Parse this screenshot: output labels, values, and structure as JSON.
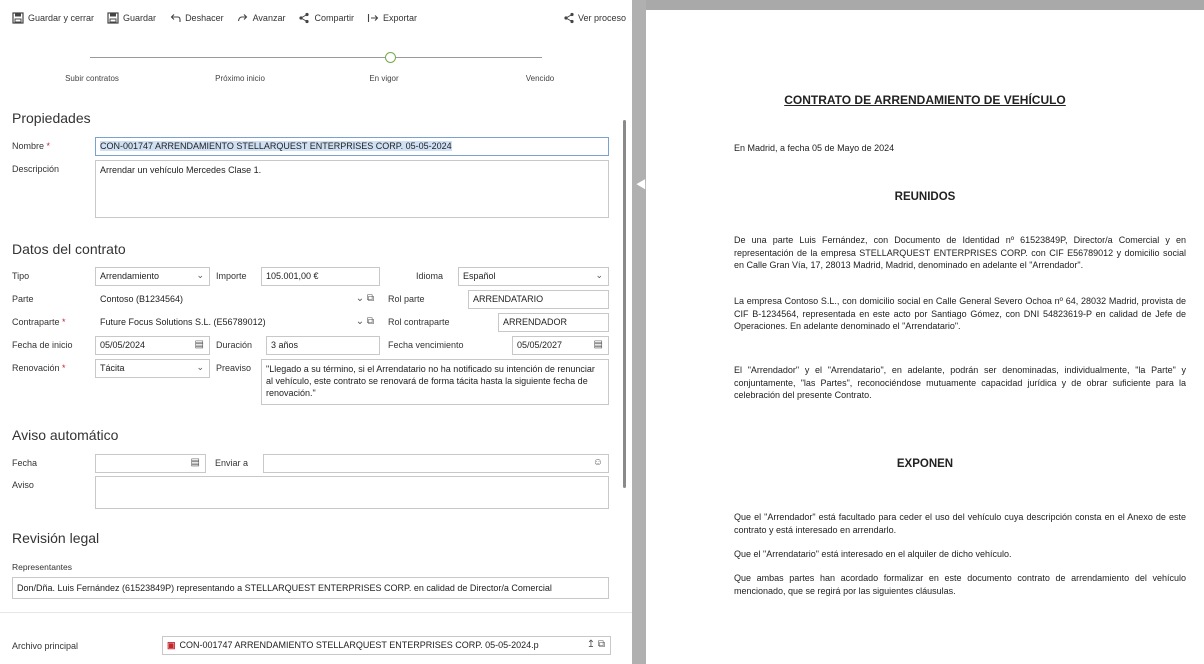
{
  "toolbar": {
    "save_close": "Guardar y cerrar",
    "save": "Guardar",
    "undo": "Deshacer",
    "redo": "Avanzar",
    "share": "Compartir",
    "export": "Exportar",
    "view_process": "Ver proceso"
  },
  "stages": [
    "Subir contratos",
    "Próximo inicio",
    "En vigor",
    "Vencido"
  ],
  "properties": {
    "title": "Propiedades",
    "name_label": "Nombre",
    "name_value": "CON-001747 ARRENDAMIENTO STELLARQUEST ENTERPRISES CORP. 05-05-2024",
    "desc_label": "Descripción",
    "desc_value": "Arrendar un vehículo Mercedes Clase 1."
  },
  "contract": {
    "title": "Datos del contrato",
    "tipo_label": "Tipo",
    "tipo_value": "Arrendamiento",
    "importe_label": "Importe",
    "importe_value": "105.001,00 €",
    "idioma_label": "Idioma",
    "idioma_value": "Español",
    "parte_label": "Parte",
    "parte_value": "Contoso (B1234564)",
    "rol_parte_label": "Rol parte",
    "rol_parte_value": "ARRENDATARIO",
    "contraparte_label": "Contraparte",
    "contraparte_value": "Future Focus Solutions S.L. (E56789012)",
    "rol_contraparte_label": "Rol contraparte",
    "rol_contraparte_value": "ARRENDADOR",
    "fecha_inicio_label": "Fecha de inicio",
    "fecha_inicio_value": "05/05/2024",
    "duracion_label": "Duración",
    "duracion_value": "3 años",
    "fecha_venc_label": "Fecha vencimiento",
    "fecha_venc_value": "05/05/2027",
    "renovacion_label": "Renovación",
    "renovacion_value": "Tácita",
    "preaviso_label": "Preaviso",
    "preaviso_value": "\"Llegado a su término, si el Arrendatario no ha notificado su intención de renunciar al vehículo, este contrato se renovará de forma tácita hasta la siguiente fecha de renovación.\""
  },
  "aviso": {
    "title": "Aviso automático",
    "fecha_label": "Fecha",
    "enviar_label": "Enviar a",
    "aviso_label": "Aviso"
  },
  "legal": {
    "title": "Revisión legal",
    "rep_label": "Representantes",
    "rep_value": "Don/Dña. Luis Fernández (61523849P) representando a STELLARQUEST ENTERPRISES CORP. en calidad de Director/a Comercial"
  },
  "archivo": {
    "label": "Archivo principal",
    "value": "CON-001747 ARRENDAMIENTO STELLARQUEST ENTERPRISES CORP. 05-05-2024.p"
  },
  "doc": {
    "title": "CONTRATO DE ARRENDAMIENTO DE VEHÍCULO",
    "place_date": "En Madrid, a fecha 05 de Mayo de 2024",
    "reunidos": "REUNIDOS",
    "p1": "De una parte Luis Fernández, con Documento de Identidad nº 61523849P, Director/a Comercial y en representación de la empresa STELLARQUEST ENTERPRISES CORP. con CIF E56789012 y domicilio social en Calle Gran Vía, 17, 28013 Madrid, Madrid, denominado en adelante el \"Arrendador\".",
    "p2": "La empresa Contoso S.L., con domicilio social en Calle General Severo Ochoa nº 64, 28032 Madrid, provista de CIF B-1234564, representada en este acto por Santiago Gómez, con DNI 54823619-P en calidad de Jefe de Operaciones. En adelante denominado el \"Arrendatario\".",
    "p3": "El \"Arrendador\" y el \"Arrendatario\", en adelante, podrán ser denominadas, individualmente, \"la Parte\" y conjuntamente, \"las Partes\", reconociéndose mutuamente capacidad jurídica y de obrar suficiente para la celebración del presente Contrato.",
    "exponen": "EXPONEN",
    "p4": "Que el \"Arrendador\" está facultado para ceder el uso del vehículo cuya descripción consta en el Anexo de este contrato y está interesado en arrendarlo.",
    "p5": "Que el \"Arrendatario\" está interesado en el alquiler de dicho vehículo.",
    "p6": "Que ambas partes han acordado formalizar en este documento contrato de arrendamiento del vehículo mencionado, que se regirá por las siguientes cláusulas."
  }
}
